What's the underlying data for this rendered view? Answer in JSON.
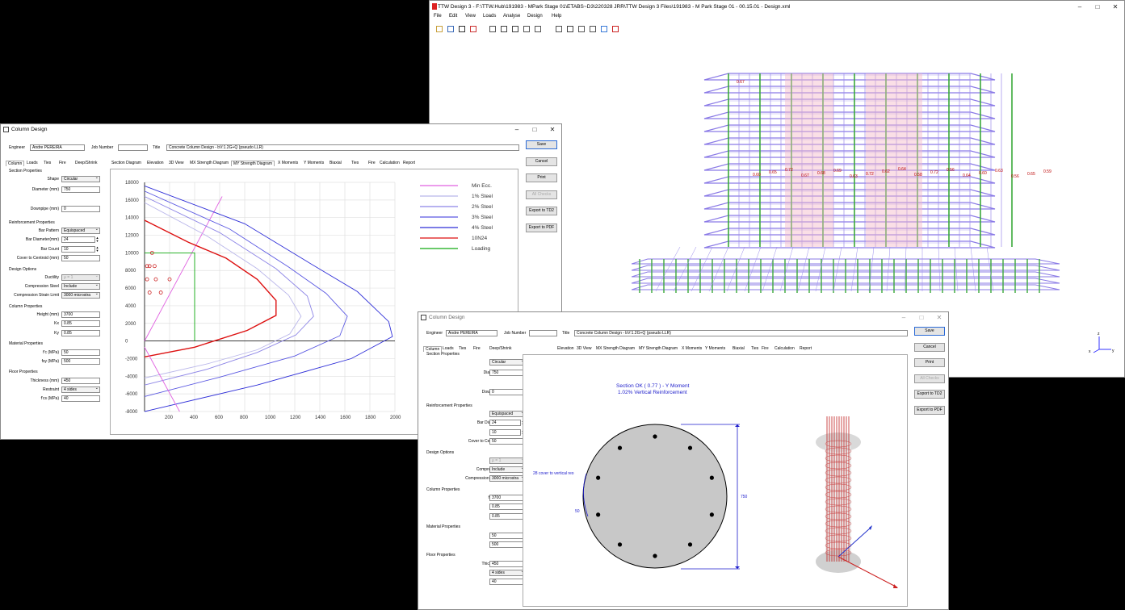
{
  "ttw_window": {
    "title": "TTW Design 3 - F:\\TTW.Hub\\191983 - MPark Stage 01\\ETABS~D3\\220328 JRR\\TTW Design 3 Files\\191983 - M Park Stage 01 - 00.15.01 - Design.xml",
    "menu": [
      "File",
      "Edit",
      "View",
      "Loads",
      "Analyse",
      "Design",
      "Help"
    ],
    "toolbar_icons": [
      "open-icon",
      "import-icon",
      "save-icon",
      "delete-icon",
      "move-icon",
      "rotate-icon",
      "pan-icon",
      "select-icon",
      "measure-icon",
      "layers-icon",
      "building-icon",
      "section-icon",
      "view-icon",
      "settings-icon",
      "help-icon"
    ],
    "model_labels": [
      "0.67",
      "0.60",
      "0.65",
      "0.72",
      "0.67",
      "0.68",
      "0.69",
      "0.63",
      "0.72",
      "0.62",
      "0.64",
      "0.58",
      "0.72",
      "0.56",
      "0.64",
      "0.60",
      "0.63",
      "0.56",
      "0.65",
      "0.59"
    ],
    "axis": {
      "z": "z",
      "y": "y",
      "x": "x"
    }
  },
  "cd1": {
    "title": "Column Design",
    "engineer_label": "Engineer",
    "engineer": "Andre PEREIRA",
    "job_label": "Job Number",
    "job": "",
    "title_label": "Title",
    "doc_title": "Concrete Column Design - bV:1.2G+Q (pseudo LLR)",
    "left_tabs": [
      "Column",
      "Loads",
      "Ties",
      "Fire",
      "Deep/Shrink"
    ],
    "tabs": [
      "Section Diagram",
      "Elevation",
      "3D View",
      "MX Strength Diagram",
      "MY Strength Diagram",
      "X Moments",
      "Y Moments",
      "Biaxial",
      "Ties",
      "Fire",
      "Calculation",
      "Report"
    ],
    "buttons": [
      "Save",
      "Cancel",
      "Print",
      "All Checks",
      "Export to TD2",
      "Export to PDF"
    ]
  },
  "form": {
    "section_props": "Section Properties",
    "shape_label": "Shape",
    "shape": "Circular",
    "diameter_label": "Diameter (mm)",
    "diameter": "750",
    "downpipe_label": "Downpipe (mm)",
    "downpipe": "0",
    "reinf_props": "Reinforcement Properties",
    "pattern_label": "Bar Pattern",
    "pattern": "Equispaced",
    "bardia_label": "Bar Diameter(mm)",
    "bardia": "24",
    "barcount_label": "Bar Count",
    "barcount": "10",
    "cover_label": "Cover to Centroid (mm)",
    "cover": "50",
    "design_opts": "Design Options",
    "ductility_label": "Ductility",
    "ductility": "μ = 1",
    "compsteel_label": "Compression Steel",
    "compsteel": "Include",
    "compstrain_label": "Compression Strain Limit",
    "compstrain": "3000 microstra",
    "col_props": "Column Properties",
    "height_label": "Height (mm)",
    "height": "3700",
    "kx_label": "Kx",
    "kx": "0.85",
    "ky_label": "Ky",
    "ky": "0.85",
    "mat_props": "Material Properties",
    "fc_label": "f'c (MPa)",
    "fc": "50",
    "fsy_label": "fsy (MPa)",
    "fsy": "500",
    "floor_props": "Floor Properties",
    "thick_label": "Thickness (mm)",
    "thick": "450",
    "restraint_label": "Restraint",
    "restraint": "4 sides",
    "fcs_label": "f'cs (MPa)",
    "fcs": "40"
  },
  "chart_data": {
    "type": "line",
    "x_ticks": [
      200,
      400,
      600,
      800,
      1000,
      1200,
      1400,
      1600,
      1800,
      2000
    ],
    "y_ticks": [
      18000,
      16000,
      14000,
      12000,
      10000,
      8000,
      6000,
      4000,
      2000,
      0,
      -2000,
      -4000,
      -6000,
      -8000
    ],
    "xlim": [
      0,
      2000
    ],
    "ylim": [
      -8000,
      18000
    ],
    "grid": true,
    "legend_position": "right",
    "series": [
      {
        "name": "Min Ecc.",
        "color": "#e060e0",
        "x": [
          0,
          620
        ],
        "y": [
          0,
          16400
        ]
      },
      {
        "name": "1% Steel",
        "color": "#b9b6ea",
        "x": [
          0,
          500,
          900,
          1150,
          1250,
          1160,
          900,
          500,
          0
        ],
        "y": [
          15700,
          11900,
          8200,
          5200,
          2800,
          800,
          -1000,
          -2600,
          -4200
        ]
      },
      {
        "name": "2% Steel",
        "color": "#8c84e6",
        "x": [
          0,
          600,
          1050,
          1300,
          1350,
          1210,
          900,
          500,
          0
        ],
        "y": [
          16400,
          12300,
          8200,
          5100,
          2800,
          700,
          -1300,
          -3200,
          -5000
        ]
      },
      {
        "name": "3% Steel",
        "color": "#5a58e2",
        "x": [
          0,
          680,
          1150,
          1450,
          1620,
          1560,
          1200,
          600,
          0
        ],
        "y": [
          17000,
          12700,
          8400,
          5400,
          2800,
          600,
          -1700,
          -4100,
          -6300
        ]
      },
      {
        "name": "4% Steel",
        "color": "#2f2fd8",
        "x": [
          0,
          800,
          1300,
          1700,
          1950,
          1980,
          1650,
          900,
          0
        ],
        "y": [
          17600,
          13300,
          9000,
          5600,
          2200,
          500,
          -2000,
          -5000,
          -8000
        ]
      },
      {
        "name": "10N24",
        "color": "#dd1111",
        "x": [
          0,
          350,
          650,
          900,
          1050,
          1050,
          820,
          400,
          0
        ],
        "y": [
          13700,
          11200,
          9400,
          7000,
          4600,
          2900,
          1200,
          -700,
          -1800
        ]
      },
      {
        "name": "Loading",
        "color": "#11aa11",
        "x": [
          0,
          400,
          400
        ],
        "y": [
          10000,
          10000,
          0
        ]
      }
    ],
    "load_points_x": [
      60,
      20,
      40,
      80,
      200,
      20,
      90,
      130,
      40
    ],
    "load_points_y": [
      10000,
      8500,
      8500,
      8500,
      7000,
      7000,
      7000,
      5500,
      5500
    ]
  },
  "cd2": {
    "title": "Column Design",
    "engineer_label": "Engineer",
    "engineer": "Andre PEREIRA",
    "job_label": "Job Number",
    "job": "",
    "title_label": "Title",
    "doc_title": "Concrete Column Design - bV:1.2G+Q (pseudo LLR)",
    "left_tabs": [
      "Column",
      "Loads",
      "Ties",
      "Fire",
      "Deep/Shrink"
    ],
    "tabs": [
      "Elevation",
      "3D View",
      "MX Strength Diagram",
      "MY Strength Diagram",
      "X Moments",
      "Y Moments",
      "Biaxial",
      "Ties",
      "Fire",
      "Calculation",
      "Report"
    ],
    "buttons": [
      "Save",
      "Cancel",
      "Print",
      "All Checks",
      "Export to TD2",
      "Export to PDF"
    ],
    "status1": "Section OK ( 0.77 ) - Y Moment",
    "status2": "1.02% Vertical Reinforcement",
    "cover_note": "28 cover to vertical reo",
    "dim_750": "750",
    "dim_50": "50"
  }
}
